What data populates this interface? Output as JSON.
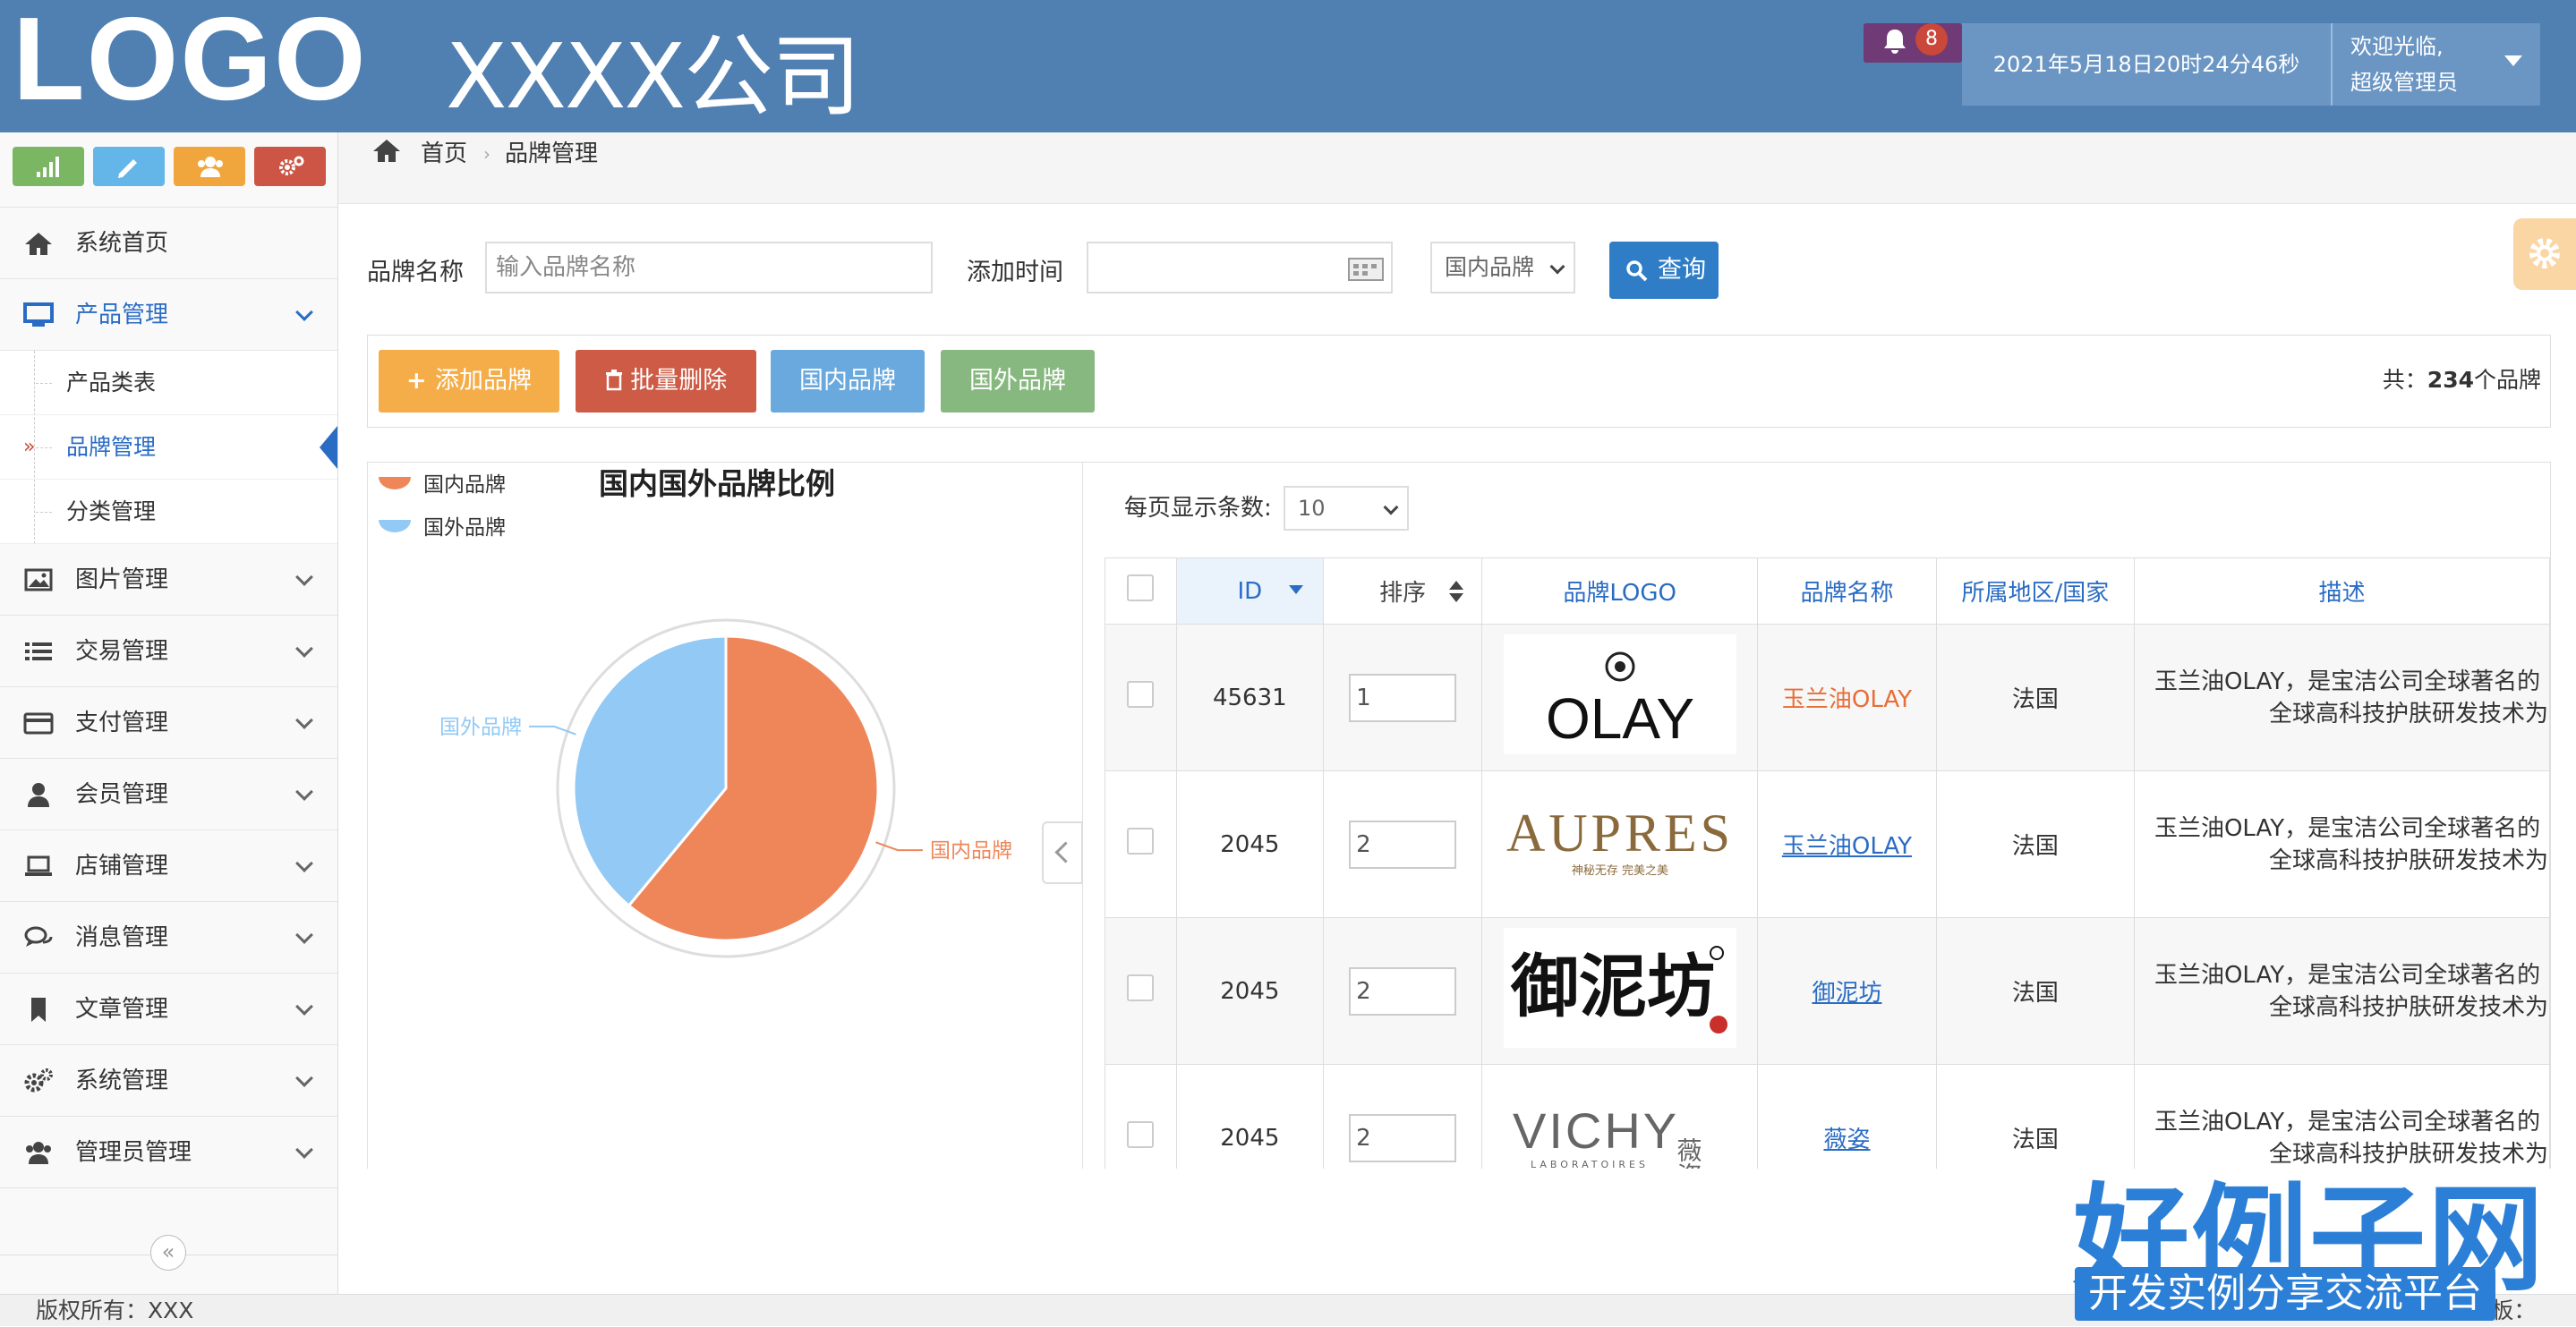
{
  "header": {
    "logo": "LOGO",
    "company": "XXXX公司",
    "notification_count": "8",
    "datetime": "2021年5月18日20时24分46秒",
    "welcome_line1": "欢迎光临,",
    "welcome_line2": "超级管理员"
  },
  "shortcuts": [
    {
      "icon": "signal-icon",
      "color": "#7bb662"
    },
    {
      "icon": "pencil-icon",
      "color": "#64b5e8"
    },
    {
      "icon": "users-icon",
      "color": "#f0a63d"
    },
    {
      "icon": "cogs-icon",
      "color": "#cc5545"
    }
  ],
  "sidebar": {
    "items": [
      {
        "label": "系统首页",
        "icon": "home-icon"
      },
      {
        "label": "产品管理",
        "icon": "monitor-icon",
        "active": true
      },
      {
        "label": "图片管理",
        "icon": "picture-icon"
      },
      {
        "label": "交易管理",
        "icon": "list-icon"
      },
      {
        "label": "支付管理",
        "icon": "credit-card-icon"
      },
      {
        "label": "会员管理",
        "icon": "user-icon"
      },
      {
        "label": "店铺管理",
        "icon": "laptop-icon"
      },
      {
        "label": "消息管理",
        "icon": "comments-icon"
      },
      {
        "label": "文章管理",
        "icon": "bookmark-icon"
      },
      {
        "label": "系统管理",
        "icon": "cogs-icon"
      },
      {
        "label": "管理员管理",
        "icon": "users-icon"
      }
    ],
    "subitems": [
      {
        "label": "产品类表"
      },
      {
        "label": "品牌管理",
        "active": true
      },
      {
        "label": "分类管理"
      }
    ],
    "collapse_glyph": "«"
  },
  "breadcrumb": {
    "home": "首页",
    "sep": "›",
    "current": "品牌管理"
  },
  "search": {
    "brand_label": "品牌名称",
    "brand_placeholder": "输入品牌名称",
    "time_label": "添加时间",
    "select_value": "国内品牌",
    "query_label": "查询"
  },
  "toolbar": {
    "add_label": "添加品牌",
    "batch_delete_label": "批量删除",
    "domestic_label": "国内品牌",
    "foreign_label": "国外品牌",
    "count_prefix": "共：",
    "count_value": "234",
    "count_suffix": "个品牌",
    "colors": {
      "add": "#f4ad49",
      "delete": "#cd5b45",
      "domestic": "#6aa9dd",
      "foreign": "#87b87f"
    }
  },
  "chart_data": {
    "type": "pie",
    "title": "国内国外品牌比例",
    "legend": [
      "国内品牌",
      "国外品牌"
    ],
    "legend_position": "top-left",
    "series": [
      {
        "name": "国内品牌",
        "value": 61,
        "color": "#ef8659"
      },
      {
        "name": "国外品牌",
        "value": 39,
        "color": "#92c9f5"
      }
    ]
  },
  "table": {
    "per_page_label": "每页显示条数:",
    "per_page_value": "10",
    "columns": [
      "ID",
      "排序",
      "品牌LOGO",
      "品牌名称",
      "所属地区/国家",
      "描述"
    ],
    "rows": [
      {
        "id": "45631",
        "order": "1",
        "logo": "OLAY",
        "name": "玉兰油OLAY",
        "region": "法国",
        "desc1": "玉兰油OLAY，是宝洁公司全球著名的",
        "desc2": "全球高科技护肤研发技术为"
      },
      {
        "id": "2045",
        "order": "2",
        "logo": "AUPRES",
        "logo_sub": "神秘无存 完美之美",
        "name": "玉兰油OLAY",
        "region": "法国",
        "desc1": "玉兰油OLAY，是宝洁公司全球著名的",
        "desc2": "全球高科技护肤研发技术为"
      },
      {
        "id": "2045",
        "order": "2",
        "logo": "御泥坊",
        "name": "御泥坊",
        "region": "法国",
        "desc1": "玉兰油OLAY，是宝洁公司全球著名的",
        "desc2": "全球高科技护肤研发技术为"
      },
      {
        "id": "2045",
        "order": "2",
        "logo": "VICHY",
        "logo_cn": "薇姿",
        "logo_sub": "LABORATOIRES",
        "name": "薇姿",
        "region": "法国",
        "desc1": "玉兰油OLAY，是宝洁公司全球著名的",
        "desc2": "全球高科技护肤研发技术为"
      }
    ]
  },
  "footer": {
    "copyright": "版权所有：XXX",
    "right_text": "地址：XXX 更多模板："
  },
  "watermark": {
    "title": "好例子网",
    "subtitle": "开发实例分享交流平台"
  }
}
